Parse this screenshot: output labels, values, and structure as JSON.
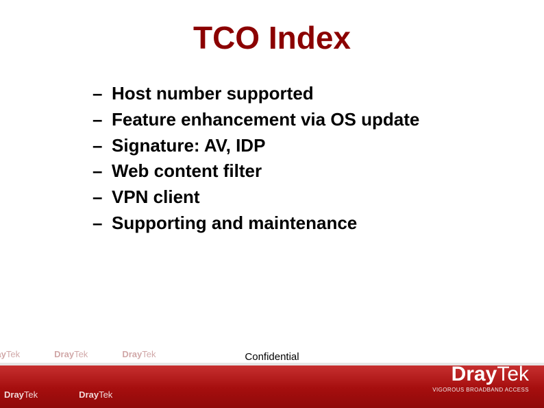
{
  "title": "TCO Index",
  "bullets": {
    "items": [
      {
        "text": "Host number supported"
      },
      {
        "text": "Feature enhancement via OS update"
      },
      {
        "text": "Signature: AV, IDP"
      },
      {
        "text": "Web content filter"
      },
      {
        "text": "VPN client"
      },
      {
        "text": "Supporting and maintenance"
      }
    ]
  },
  "footer": {
    "confidential": "Confidential",
    "brand_bold": "Dray",
    "brand_light": "Tek",
    "tagline": "VIGOROUS BROADBAND ACCESS"
  }
}
